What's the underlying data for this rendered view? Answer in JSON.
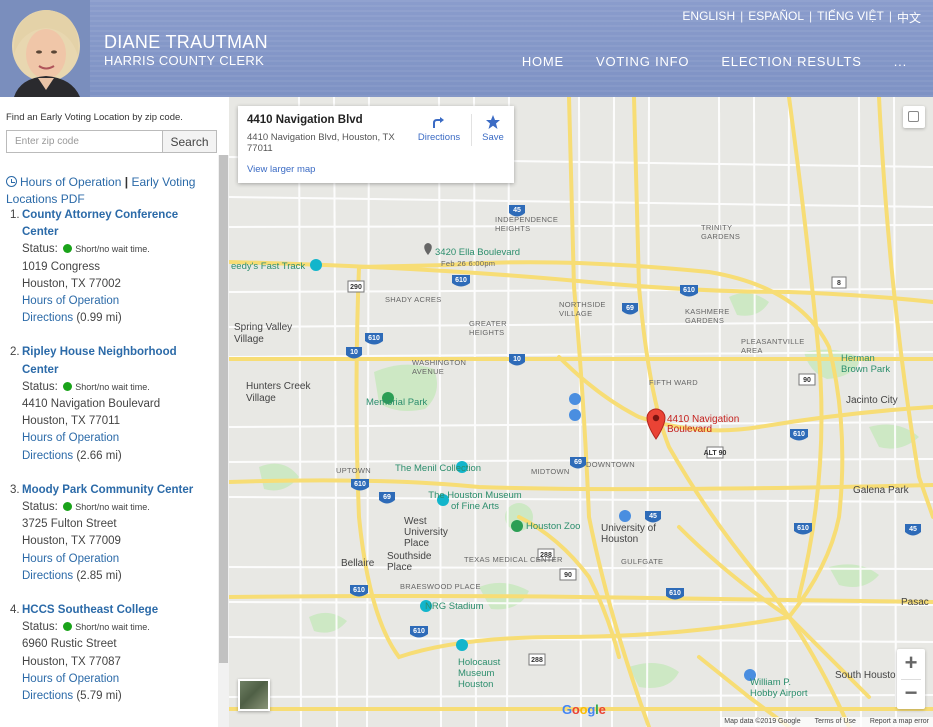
{
  "header": {
    "name": "DIANE TRAUTMAN",
    "title": "HARRIS COUNTY CLERK",
    "languages": [
      "ENGLISH",
      "ESPAÑOL",
      "TIẾNG VIỆT",
      "中文"
    ],
    "nav": [
      "HOME",
      "VOTING INFO",
      "ELECTION RESULTS",
      "..."
    ],
    "colors": {
      "header_bg": "#8497c8",
      "link": "#2b6aa8",
      "status_green": "#1aa31a"
    }
  },
  "sidebar": {
    "prompt": "Find an Early Voting Location by zip code.",
    "zip_placeholder": "Enter zip code",
    "search_label": "Search",
    "hours_link": "Hours of Operation",
    "separator": "|",
    "pdf_link": "Early Voting Locations PDF",
    "locations": [
      {
        "num": "1.",
        "name": "County Attorney Conference Center",
        "status_label": "Status:",
        "wait": "Short/no wait time.",
        "street": "1019 Congress",
        "city": "Houston, TX 77002",
        "hours": "Hours of Operation",
        "directions": "Directions",
        "distance": "(0.99 mi)"
      },
      {
        "num": "2.",
        "name": "Ripley House Neighborhood Center",
        "status_label": "Status:",
        "wait": "Short/no wait time.",
        "street": "4410 Navigation Boulevard",
        "city": "Houston, TX 77011",
        "hours": "Hours of Operation",
        "directions": "Directions",
        "distance": "(2.66 mi)"
      },
      {
        "num": "3.",
        "name": "Moody Park Community Center",
        "status_label": "Status:",
        "wait": "Short/no wait time.",
        "street": "3725 Fulton Street",
        "city": "Houston, TX 77009",
        "hours": "Hours of Operation",
        "directions": "Directions",
        "distance": "(2.85 mi)"
      },
      {
        "num": "4.",
        "name": "HCCS Southeast College",
        "status_label": "Status:",
        "wait": "Short/no wait time.",
        "street": "6960 Rustic Street",
        "city": "Houston, TX 77087",
        "hours": "Hours of Operation",
        "directions": "Directions",
        "distance": "(5.79 mi)"
      }
    ]
  },
  "map": {
    "card": {
      "title": "4410 Navigation Blvd",
      "address": "4410 Navigation Blvd, Houston, TX 77011",
      "view_larger": "View larger map",
      "directions": "Directions",
      "save": "Save"
    },
    "pin_label": "4410 Navigation Boulevard",
    "attribution": [
      "Map data ©2019 Google",
      "Terms of Use",
      "Report a map error"
    ],
    "labels": {
      "ella": "3420 Ella Boulevard",
      "ella_time": "Feb 26 6:00pm",
      "fast_track": "eedy's Fast Track",
      "spring_valley": "Spring Valley Village",
      "hunters_creek": "Hunters Creek Village",
      "memorial_park": "Memorial Park",
      "menil": "The Menil Collection",
      "mfa": "The Houston Museum of Fine Arts",
      "zoo": "Houston Zoo",
      "univ_houston": "University of Houston",
      "west_univ": "West University Place",
      "southside": "Southside Place",
      "bellaire": "Bellaire",
      "nrg": "NRG Stadium",
      "holocaust": "Holocaust Museum Houston",
      "herman": "Herman Brown Park",
      "jacinto": "Jacinto City",
      "galena": "Galena Park",
      "hobby": "William P. Hobby Airport",
      "pasadena": "Pasac",
      "south_houston": "South Housto",
      "shady_acres": "SHADY ACRES",
      "northside": "NORTHSIDE VILLAGE",
      "greater_heights": "GREATER HEIGHTS",
      "kashmere": "KASHMERE GARDENS",
      "fifth_ward": "FIFTH WARD",
      "washington": "WASHINGTON AVENUE",
      "midtown": "MIDTOWN",
      "downtown": "DOWNTOWN",
      "uptown": "UPTOWN",
      "texas_medical": "TEXAS MEDICAL CENTER",
      "braeswood": "BRAESWOOD PLACE",
      "gulfgate": "GULFGATE",
      "pleasantville": "PLEASANTVILLE AREA",
      "trinity": "TRINITY GARDENS",
      "independence": "INDEPENDENCE HEIGHTS"
    }
  }
}
